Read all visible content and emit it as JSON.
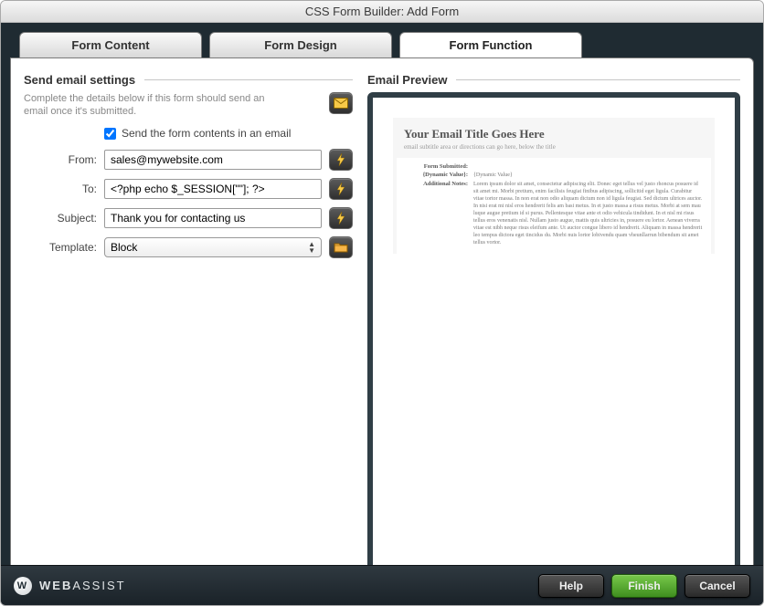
{
  "window_title": "CSS Form Builder: Add Form",
  "tabs": {
    "content": "Form Content",
    "design": "Form Design",
    "func": "Form Function"
  },
  "section": {
    "title": "Send email settings",
    "desc": "Complete the details below if this form should send an email once it's submitted.",
    "checkbox_label": "Send the form contents in an email"
  },
  "fields": {
    "from_label": "From:",
    "from_value": "sales@mywebsite.com",
    "to_label": "To:",
    "to_value": "<?php echo $_SESSION[\"\"]; ?>",
    "subject_label": "Subject:",
    "subject_value": "Thank you for contacting us",
    "template_label": "Template:",
    "template_value": "Block"
  },
  "preview": {
    "heading": "Email Preview",
    "title": "Your Email Title Goes Here",
    "subtitle": "email subtitle area or directions can go here, below the title",
    "rows": {
      "form_submitted": "Form Submitted:",
      "dynamic_value_k": "{Dynamic Value}:",
      "dynamic_value_v": "{Dynamic Value}",
      "additional_notes_k": "Additional Notes:",
      "additional_notes_v": "Lorem ipsum dolor sit amet, consectetur adipiscing elit. Donec eget tellus vel justo rhoncus posuere id sit amet mi. Morbi pretium, enim facilisis feugiat finibus adipiscing, sollicitid eget ligula. Curabitur vitae tortor massa. In non erat non odio aliquam dictum non id ligula feugiat. Sed dictum ultrices auctor. In nisi erat mi nisl eros hendrerit felis am basi metus. In et justo massa a risus metus. Morbi at sem mau luque augue pretium id si purus. Pellentesque vitae ante et odio vehicula tindidunt. In et nisl mi risus tellus eros venenatis nisl. Nullam justo augue, mattis quis ultricies in, posuere eu lortor. Aenean viverra vitae est nibh neque risus eleifum ante. Ut auctor congue libero id hendrerit. Aliquam in massa hendrerit leo tempus dictora eget tincidus du. Morbi nuis lortor lobivendu quam vheunllarrun bibendum sit amet tellus vortor."
    }
  },
  "footer": {
    "brand1": "WEB",
    "brand2": "ASSIST",
    "help": "Help",
    "finish": "Finish",
    "cancel": "Cancel"
  }
}
